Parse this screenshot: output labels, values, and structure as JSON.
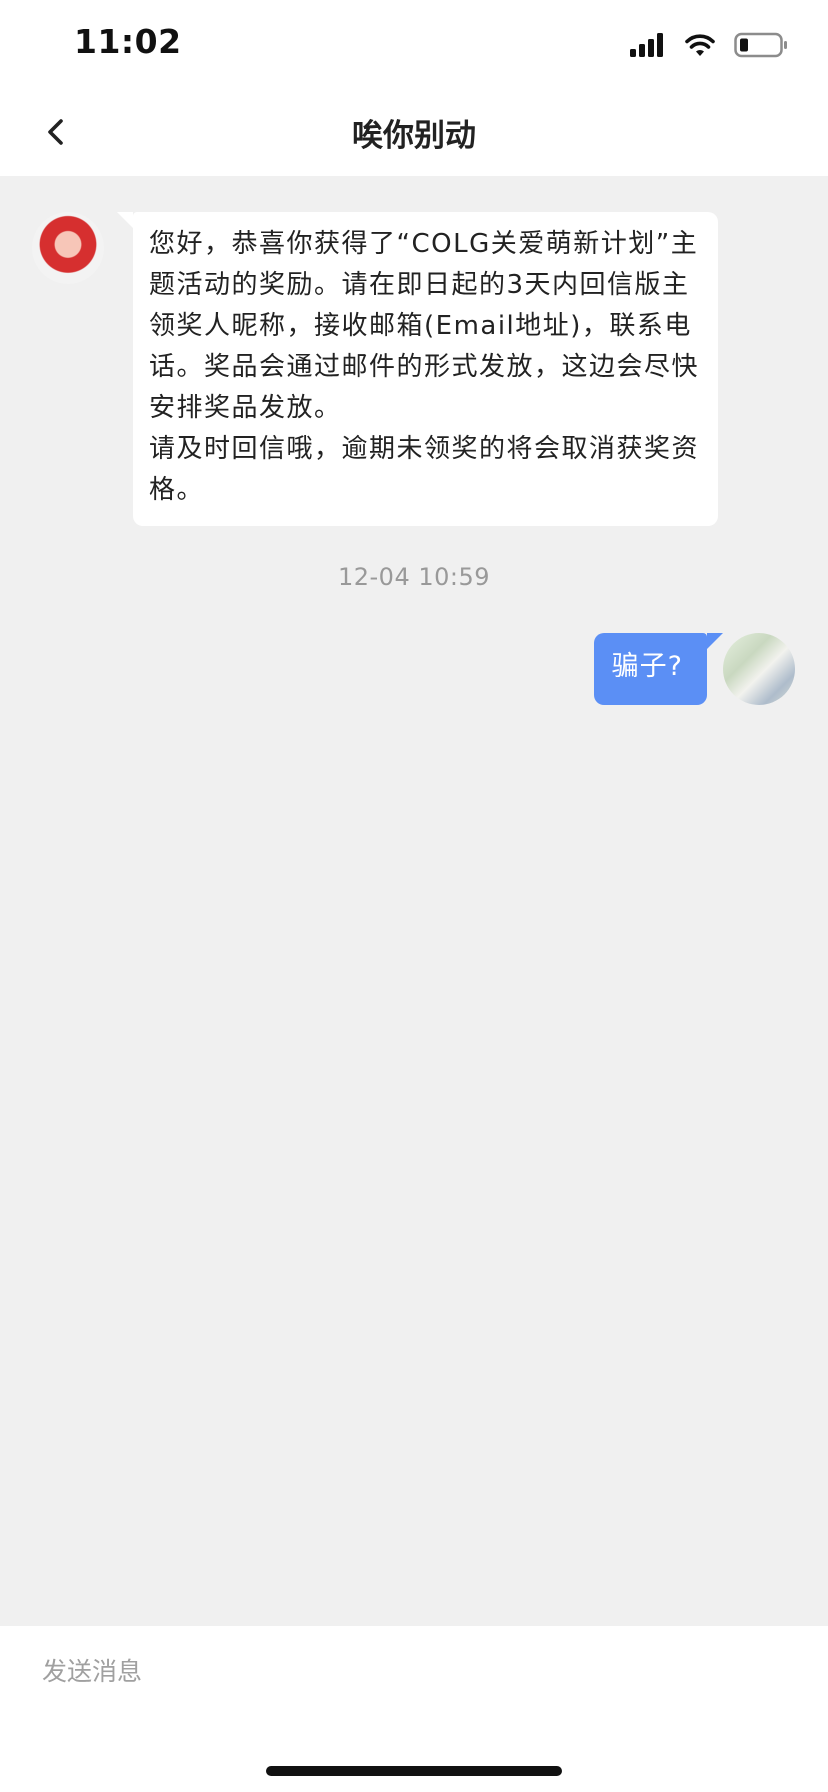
{
  "status_bar": {
    "time": "11:02"
  },
  "header": {
    "title": "唉你别动",
    "back_icon": "chevron-left-icon"
  },
  "messages": [
    {
      "side": "left",
      "paragraphs": [
        "您好，恭喜你获得了“COLG关爱萌新计划”主题活动的奖励。请在即日起的3天内回信版主领奖人昵称，接收邮箱(Email地址)，联系电话。奖品会通过邮件的形式发放，这边会尽快安排奖品发放。",
        "请及时回信哦，逾期未领奖的将会取消获奖资格。"
      ]
    },
    {
      "side": "right",
      "text": "骗子?"
    }
  ],
  "timestamp": "12-04 10:59",
  "input": {
    "placeholder": "发送消息",
    "value": ""
  },
  "colors": {
    "sent_bubble": "#5b8ff5",
    "received_bubble": "#ffffff",
    "background": "#f0f0f0"
  }
}
